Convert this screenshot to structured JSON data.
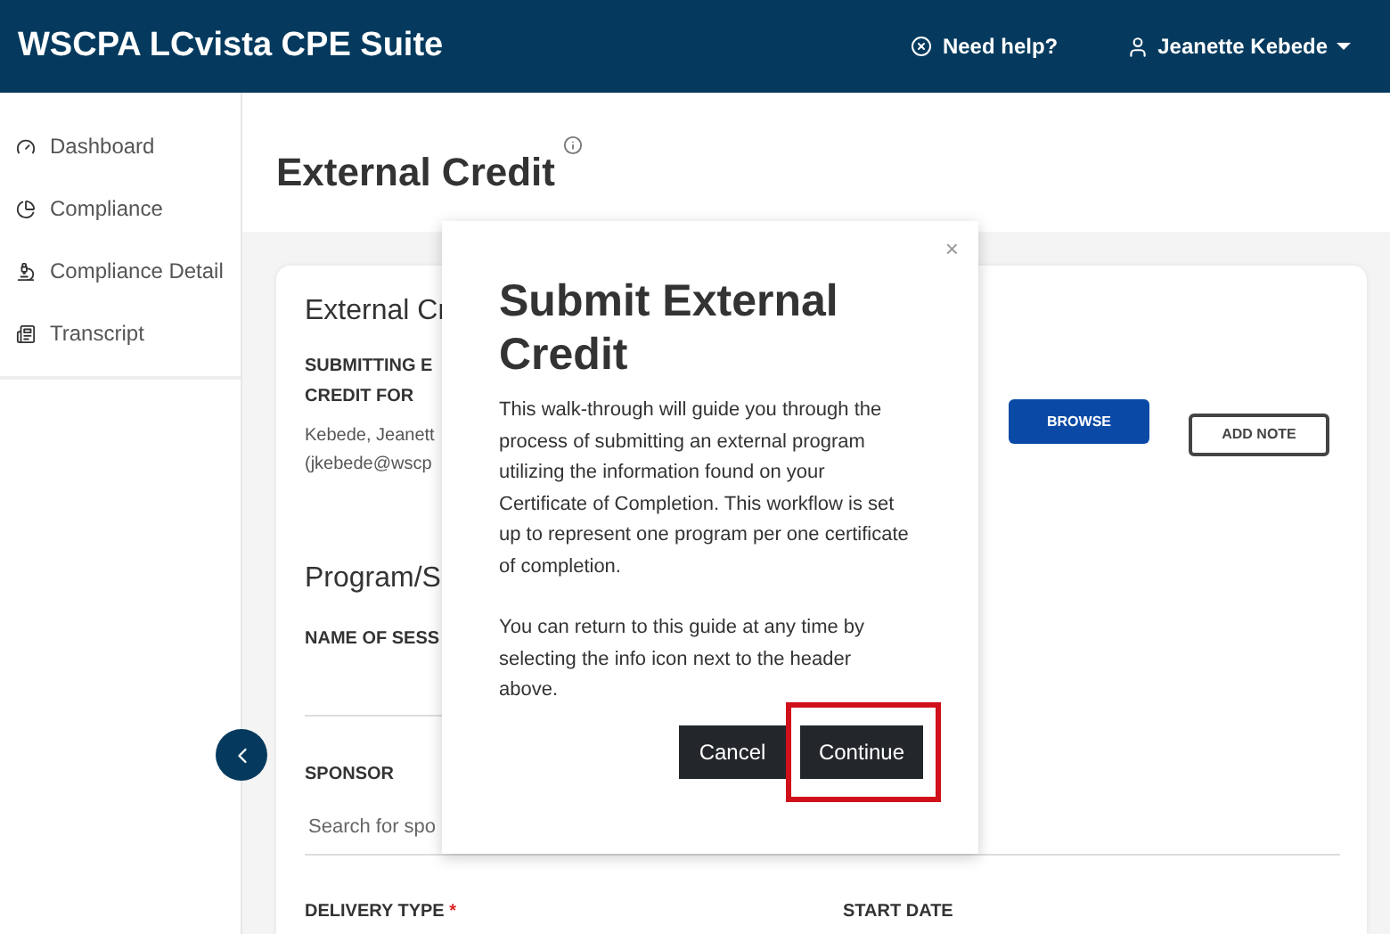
{
  "header": {
    "title": "WSCPA LCvista CPE Suite",
    "help": "Need help?",
    "user": "Jeanette Kebede"
  },
  "sidebar": {
    "items": [
      {
        "label": "Dashboard"
      },
      {
        "label": "Compliance"
      },
      {
        "label": "Compliance Detail"
      },
      {
        "label": "Transcript"
      }
    ]
  },
  "page_title": "External Credit",
  "card": {
    "title": "External Cr",
    "submitting_label": [
      "SUBMITTING E",
      "CREDIT FOR"
    ],
    "submitting_value": [
      "Kebede, Jeanett",
      "(jkebede@wscp"
    ],
    "browse": "BROWSE",
    "add_note": "ADD NOTE",
    "section_title": "Program/S",
    "name_label": "NAME OF SESS",
    "sponsor_label": "SPONSOR",
    "sponsor_placeholder": "Search for spo",
    "delivery_label": "DELIVERY TYPE",
    "delivery_required": "*",
    "start_date_label": "START DATE"
  },
  "modal": {
    "title": "Submit External Credit",
    "close": "×",
    "paragraphs": [
      "This walk-through will guide you through the process of submitting an external program utilizing the information found on your Certificate of Completion. This workflow is set up to represent one program per one certificate of completion.",
      "You can return to this guide at any time by selecting the info icon next to the header above."
    ],
    "cancel": "Cancel",
    "continue": "Continue",
    "continue_highlighted": true
  }
}
